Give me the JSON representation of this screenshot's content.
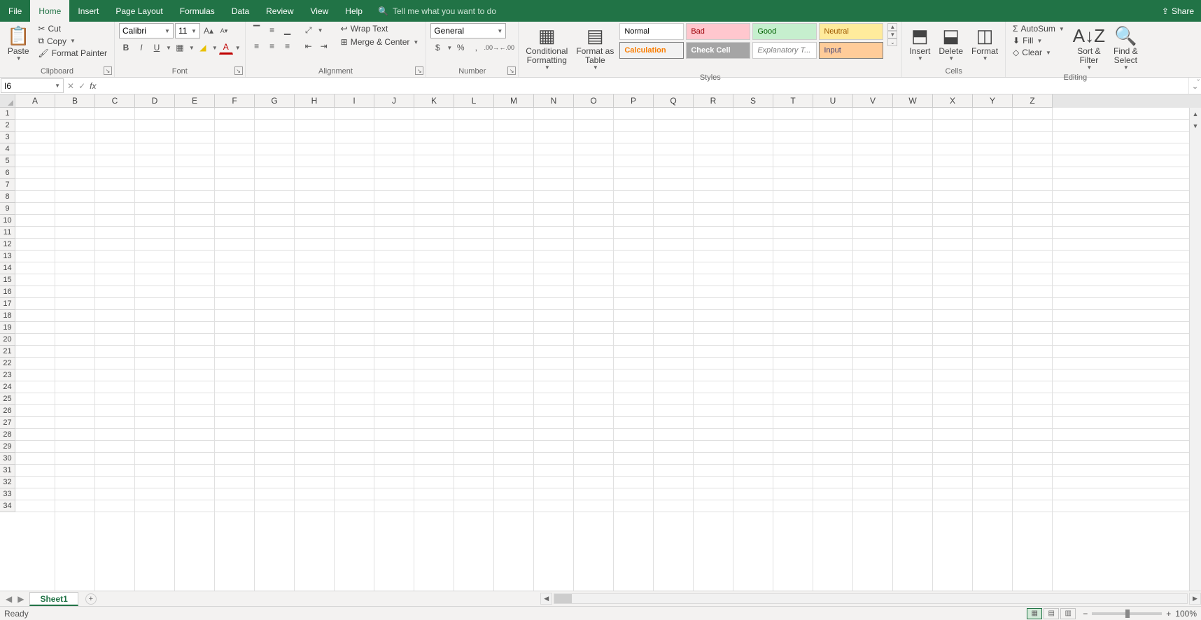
{
  "menubar": {
    "tabs": [
      "File",
      "Home",
      "Insert",
      "Page Layout",
      "Formulas",
      "Data",
      "Review",
      "View",
      "Help"
    ],
    "active": "Home",
    "tellme_placeholder": "Tell me what you want to do",
    "share": "Share"
  },
  "ribbon": {
    "clipboard": {
      "label": "Clipboard",
      "paste": "Paste",
      "cut": "Cut",
      "copy": "Copy",
      "format_painter": "Format Painter"
    },
    "font": {
      "label": "Font",
      "name": "Calibri",
      "size": "11"
    },
    "alignment": {
      "label": "Alignment",
      "wrap": "Wrap Text",
      "merge": "Merge & Center"
    },
    "number": {
      "label": "Number",
      "format": "General"
    },
    "styles": {
      "label": "Styles",
      "cond": "Conditional\nFormatting",
      "table": "Format as\nTable",
      "cells": [
        "Normal",
        "Bad",
        "Good",
        "Neutral",
        "Calculation",
        "Check Cell",
        "Explanatory T...",
        "Input"
      ]
    },
    "cells": {
      "label": "Cells",
      "insert": "Insert",
      "delete": "Delete",
      "format": "Format"
    },
    "editing": {
      "label": "Editing",
      "autosum": "AutoSum",
      "fill": "Fill",
      "clear": "Clear",
      "sort": "Sort &\nFilter",
      "find": "Find &\nSelect"
    }
  },
  "formula_bar": {
    "name_box": "I6",
    "formula": ""
  },
  "grid": {
    "columns": [
      "A",
      "B",
      "C",
      "D",
      "E",
      "F",
      "G",
      "H",
      "I",
      "J",
      "K",
      "L",
      "M",
      "N",
      "O",
      "P",
      "Q",
      "R",
      "S",
      "T",
      "U",
      "V",
      "W",
      "X",
      "Y",
      "Z"
    ],
    "rows": 34
  },
  "sheets": {
    "active": "Sheet1"
  },
  "status": {
    "mode": "Ready",
    "zoom": "100%"
  }
}
